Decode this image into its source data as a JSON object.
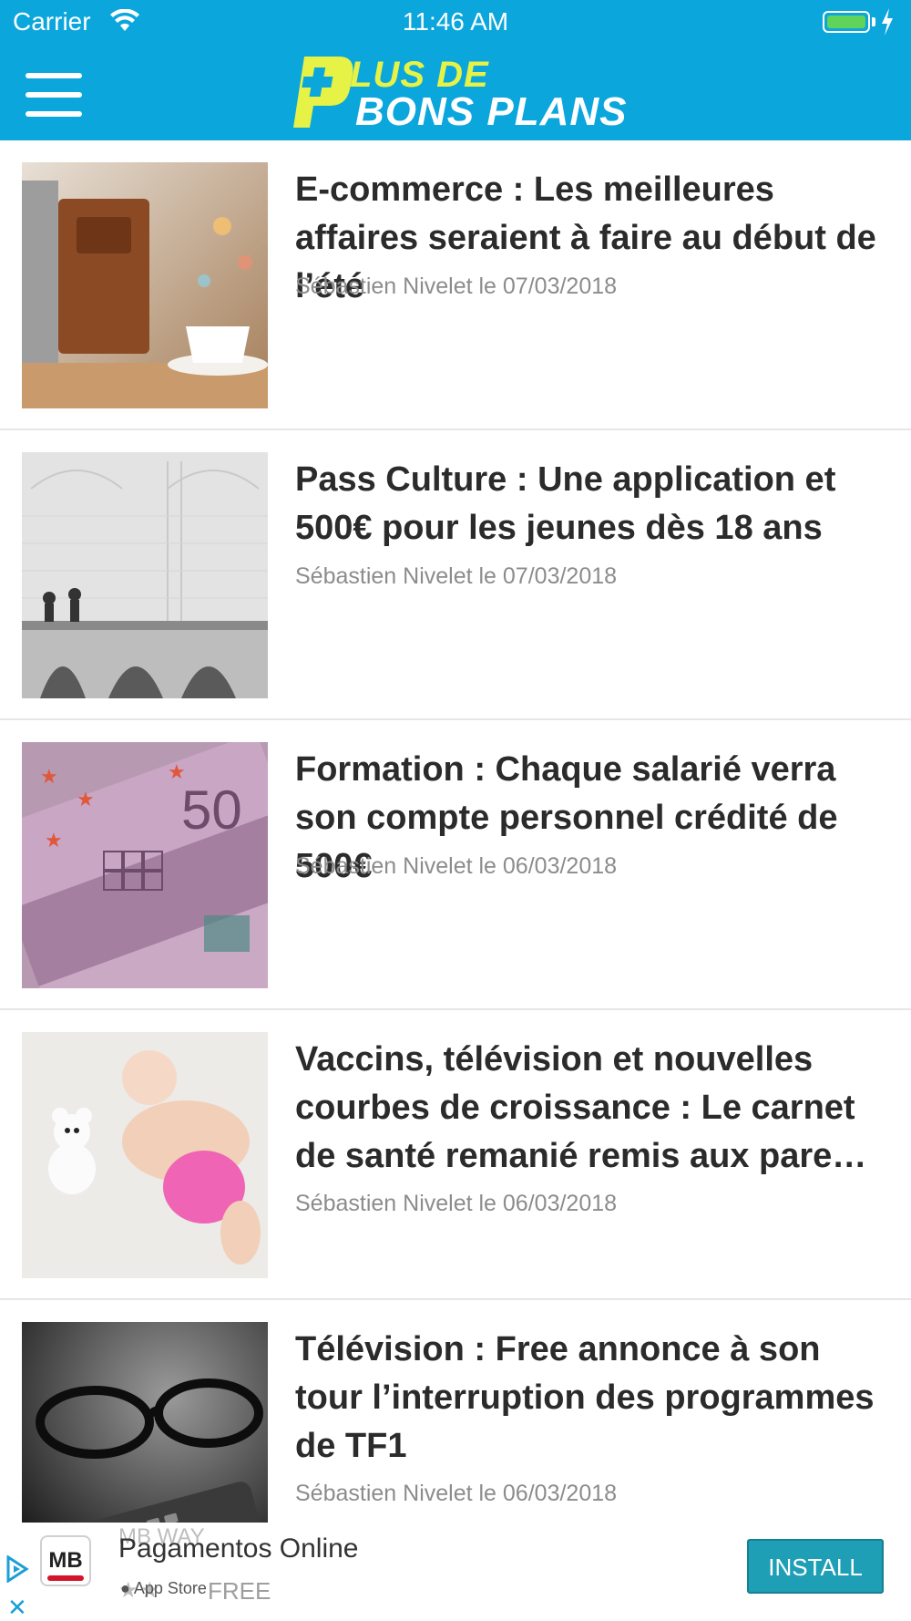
{
  "status_bar": {
    "carrier": "Carrier",
    "time": "11:46 AM"
  },
  "header": {
    "logo_line1": "LUS DE",
    "logo_line2": "BONS PLANS",
    "brand_color": "#0ba6dc",
    "logo_accent_color": "#e6f246"
  },
  "articles": [
    {
      "title": "E-commerce : Les meilleures affaires seraient à faire au début de l’été",
      "meta": "Sébastien Nivelet le 07/03/2018",
      "image": "laptop-bag-coffee-image"
    },
    {
      "title": "Pass Culture : Une application et 500€ pour les jeunes dès 18 ans",
      "meta": "Sébastien Nivelet le 07/03/2018",
      "image": "arcade-hall-image"
    },
    {
      "title": "Formation : Chaque salarié verra son compte personnel crédité de 500€",
      "meta": "Sébastien Nivelet le 06/03/2018",
      "image": "euro-banknotes-image"
    },
    {
      "title": "Vaccins, télévision et nouvelles courbes de croissance : Le carnet de santé remanié remis aux parents d…",
      "meta": "Sébastien Nivelet le 06/03/2018",
      "image": "baby-teddy-image"
    },
    {
      "title": "Télévision : Free annonce à son tour l’interruption des programmes de TF1",
      "meta": "Sébastien Nivelet le 06/03/2018",
      "image": "glasses-remote-image"
    }
  ],
  "ad": {
    "logo_text": "MB",
    "sub_brand": "MB WAY",
    "title": "Pagamentos Online",
    "store": "App Store",
    "stars": "★★",
    "price": "FREE",
    "install_label": "INSTALL",
    "install_color": "#1f9fb5"
  }
}
